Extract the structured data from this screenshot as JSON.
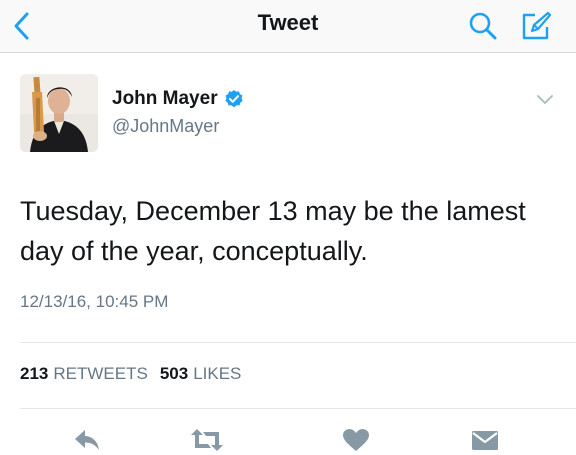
{
  "nav": {
    "title": "Tweet",
    "back_icon": "chevron-left-icon",
    "search_icon": "search-icon",
    "compose_icon": "compose-icon"
  },
  "author": {
    "name": "John Mayer",
    "handle": "@JohnMayer",
    "verified": true,
    "avatar_icon": "avatar"
  },
  "tweet": {
    "text": "Tuesday, December 13 may be the lamest day of the year, conceptually.",
    "timestamp": "12/13/16, 10:45 PM"
  },
  "stats": {
    "retweets_count": "213",
    "retweets_label": "RETWEETS",
    "likes_count": "503",
    "likes_label": "LIKES"
  },
  "actions": [
    "reply-icon",
    "retweet-icon",
    "like-icon",
    "direct-message-icon"
  ],
  "colors": {
    "accent": "#1da1f2",
    "icon_gray": "#8899a6",
    "secondary_text": "#657786",
    "primary_text": "#14171a"
  }
}
